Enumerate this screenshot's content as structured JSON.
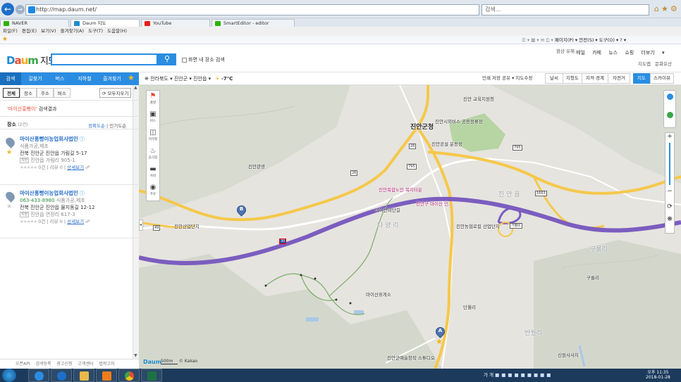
{
  "browser": {
    "url": "http://map.daum.net/",
    "search_placeholder": "검색...",
    "tabs": [
      {
        "label": "NAVER",
        "color": "#2db400"
      },
      {
        "label": "Daum 지도",
        "color": "#1d8ccf"
      },
      {
        "label": "YouTube",
        "color": "#e62117"
      },
      {
        "label": "SmartEditor - editor",
        "color": "#2db400"
      }
    ],
    "menu": "파일(F)  편집(E)  보기(V)  즐겨찾기(A)  도구(T)  도움말(H)",
    "command_bar": "페이지(P) ▾  안전(S) ▾  도구(O) ▾  ?  ▾"
  },
  "header": {
    "logo_letters": [
      "D",
      "a",
      "u",
      "m"
    ],
    "logo_suffix": "지도",
    "search_icon": "search-icon",
    "in_screen_label": "화면 내 장소 검색",
    "top_links_a": "항상 유해",
    "top_links": "메일  카페  뉴스  쇼핑  더보기 ▾",
    "sub_links": "지도맵  문화유산"
  },
  "left_nav": {
    "items": [
      "검색",
      "길찾기",
      "버스",
      "지하철",
      "즐겨찾기"
    ]
  },
  "sub_tabs": [
    "전체",
    "장소",
    "주소",
    "버스"
  ],
  "clear_button": "모두지우기",
  "result_header": {
    "query": "'마이산홍뻥이'",
    "suffix": " 검색결과"
  },
  "places_header": {
    "label": "장소",
    "count": "(2건)"
  },
  "sorts": {
    "accuracy": "정확도순",
    "popular": "인기도순"
  },
  "results": [
    {
      "name": "마이산홍뻥이농업회사법인",
      "phone": "",
      "category": "식품가공,제조",
      "address": "전북 진안군 진안읍 가림길 5-17",
      "jibun_tag": "지번",
      "jibun": "진안읍 가림리 905-1",
      "meta_prefix": "0건 | 리뷰 0 |",
      "street_view": "상세보기"
    },
    {
      "name": "마이산홍뻥이농업회사법인",
      "phone": "063-433-8980",
      "category": "식품가공,제조",
      "address": "전북 진안군 진안읍 물지동길 12-12",
      "jibun_tag": "지번",
      "jibun": "진안읍 연장리 617-3",
      "meta_prefix": "0건 | 리뷰 0 |",
      "street_view": "상세보기"
    }
  ],
  "bottom_links": "오픈API  검색등록  광고신청  고객센터  법적고지",
  "map_toolbar": {
    "region": "전라북도 ▾   진안군 ▾   진안읍 ▾",
    "weather": "-7℃",
    "tools": "인쇄  저장  공유 ▾  지도수정",
    "buttons": [
      "날씨",
      "지형도",
      "지적·경계",
      "자전거"
    ],
    "mode_buttons": [
      "지도",
      "스카이뷰"
    ]
  },
  "map_side": [
    "출발",
    "버스",
    "지하철",
    "음식점",
    "숙박",
    "주유"
  ],
  "map_labels": [
    {
      "text": "진안군청",
      "cls": "big"
    },
    {
      "text": "진안 교육지원청",
      "cls": ""
    },
    {
      "text": "진안시외버스 공용정류장",
      "cls": ""
    },
    {
      "text": "진안공설 운동장",
      "cls": ""
    },
    {
      "text": "진안복합노인 복지타운",
      "cls": "pink"
    },
    {
      "text": "진안구 마이산 인..",
      "cls": "pink"
    },
    {
      "text": "진안농협로컬 산업단지",
      "cls": ""
    },
    {
      "text": "진 안 읍",
      "cls": "dim"
    },
    {
      "text": "진안산업단지",
      "cls": ""
    },
    {
      "text": "진안관광",
      "cls": ""
    },
    {
      "text": "마이산휴게소",
      "cls": ""
    },
    {
      "text": "마이산비단길",
      "cls": ""
    },
    {
      "text": "진안군예술창작 스튜디오",
      "cls": ""
    },
    {
      "text": "반월리",
      "cls": "dim"
    },
    {
      "text": "구룡리",
      "cls": "dim"
    },
    {
      "text": "다 양 리",
      "cls": "dim"
    },
    {
      "text": "단월리",
      "cls": ""
    },
    {
      "text": "신원사사지",
      "cls": ""
    },
    {
      "text": "구룡리",
      "cls": ""
    }
  ],
  "shields": [
    "26",
    "795",
    "26",
    "30",
    "49",
    "795",
    "1663",
    "가평IC"
  ],
  "markers": [
    "A",
    "B"
  ],
  "scale": "500m",
  "copyright": "© Kakao",
  "map_logo": "Daum",
  "taskbar": {
    "tray_text": "가 개",
    "time": "오후 11:35",
    "date": "2018-01-28"
  }
}
